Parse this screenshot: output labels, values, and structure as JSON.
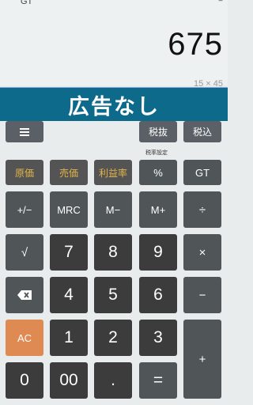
{
  "display": {
    "gt_label": "GT",
    "menu_glyph": "=",
    "result": "675",
    "expression": "15 × 45"
  },
  "ad_banner": {
    "text": "広告なし"
  },
  "top_row": {
    "menu_icon": "hamburger-menu-icon",
    "tax_exclude": "税抜",
    "tax_include": "税込",
    "tax_rate_setting": "税率設定"
  },
  "function_row": [
    "原価",
    "売価",
    "利益率",
    "%",
    "GT"
  ],
  "memory_row": [
    "+/−",
    "MRC",
    "M−",
    "M+",
    "÷"
  ],
  "rows": {
    "r1": [
      "√",
      "7",
      "8",
      "9",
      "×"
    ],
    "r2": [
      "backspace-icon",
      "4",
      "5",
      "6",
      "−"
    ],
    "r3": [
      "AC",
      "1",
      "2",
      "3",
      "+"
    ],
    "r4": [
      "0",
      "00",
      ".",
      "="
    ]
  },
  "colors": {
    "ad_bg": "#0d6a8a",
    "function_text": "#e0b44a",
    "ac_button": "#df8a52"
  }
}
